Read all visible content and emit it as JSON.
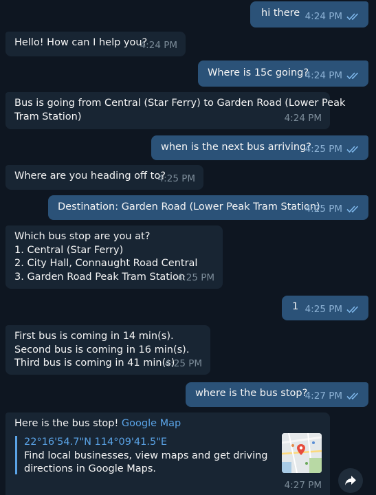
{
  "messages": [
    {
      "id": "m1",
      "dir": "out",
      "lines": [
        "hi there"
      ],
      "time": "4:24 PM",
      "read": true
    },
    {
      "id": "m2",
      "dir": "in",
      "lines": [
        "Hello! How can I help you?"
      ],
      "time": "4:24 PM"
    },
    {
      "id": "m3",
      "dir": "out",
      "lines": [
        "Where is 15c going?"
      ],
      "time": "4:24 PM",
      "read": true
    },
    {
      "id": "m4",
      "dir": "in",
      "lines": [
        "Bus is going from Central (Star Ferry) to Garden Road (Lower Peak",
        "Tram Station)"
      ],
      "time": "4:24 PM"
    },
    {
      "id": "m5",
      "dir": "out",
      "lines": [
        "when is the next bus arriving?"
      ],
      "time": "4:25 PM",
      "read": true
    },
    {
      "id": "m6",
      "dir": "in",
      "lines": [
        "Where are you heading off to?"
      ],
      "time": "4:25 PM"
    },
    {
      "id": "m7",
      "dir": "out",
      "lines": [
        "Destination: Garden Road (Lower Peak Tram Station)"
      ],
      "time": "4:25 PM",
      "read": true
    },
    {
      "id": "m8",
      "dir": "in",
      "lines": [
        "Which bus stop are you at?",
        "1. Central (Star Ferry)",
        "2. City Hall, Connaught Road Central",
        "3. Garden Road Peak Tram Station"
      ],
      "time": "4:25 PM"
    },
    {
      "id": "m9",
      "dir": "out",
      "lines": [
        "1"
      ],
      "time": "4:25 PM",
      "read": true
    },
    {
      "id": "m10",
      "dir": "in",
      "lines": [
        "First bus is coming in 14 min(s).",
        "Second bus is coming in 16 min(s).",
        "Third bus is coming in 41 min(s)"
      ],
      "time": "4:25 PM"
    },
    {
      "id": "m11",
      "dir": "out",
      "lines": [
        "where is the bus stop?"
      ],
      "time": "4:27 PM",
      "read": true
    }
  ],
  "last_message": {
    "text": "Here is the bus stop!",
    "link_text": "Google Map",
    "preview_title": "22°16'54.7\"N 114°09'41.5\"E",
    "preview_desc_1": "Find local businesses, view maps and get driving",
    "preview_desc_2": "directions in Google Maps.",
    "time": "4:27 PM",
    "thumb_icon": "map-thumbnail"
  },
  "share_icon": "share-arrow-icon",
  "colors": {
    "background": "#0e1621",
    "outgoing": "#2b5278",
    "incoming": "#182533",
    "accent": "#5aa3e6"
  }
}
